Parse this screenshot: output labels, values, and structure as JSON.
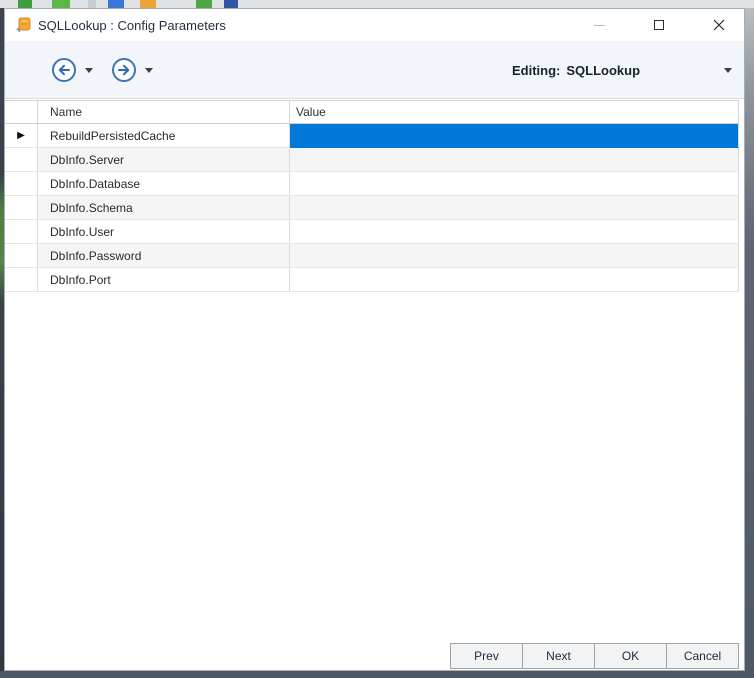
{
  "window": {
    "title": "SQLLookup : Config Parameters"
  },
  "toolbar": {
    "editing_label": "Editing:",
    "editing_value": "SQLLookup"
  },
  "grid": {
    "columns": [
      "Name",
      "Value"
    ],
    "row_indicator_glyph": "▶",
    "rows": [
      {
        "name": "RebuildPersistedCache",
        "value": "",
        "selected": true
      },
      {
        "name": "DbInfo.Server",
        "value": "",
        "selected": false
      },
      {
        "name": "DbInfo.Database",
        "value": "",
        "selected": false
      },
      {
        "name": "DbInfo.Schema",
        "value": "",
        "selected": false
      },
      {
        "name": "DbInfo.User",
        "value": "",
        "selected": false
      },
      {
        "name": "DbInfo.Password",
        "value": "",
        "selected": false
      },
      {
        "name": "DbInfo.Port",
        "value": "",
        "selected": false
      }
    ]
  },
  "footer": {
    "buttons": [
      "Prev",
      "Next",
      "OK",
      "Cancel"
    ]
  },
  "colors": {
    "selection_blue": "#0078d7",
    "toolbar_background": "#f2f5f9",
    "nav_icon_blue": "#3c72b0",
    "app_icon_orange": "#f0a43c",
    "background_edge_dark": "#4d5866"
  },
  "icons": {
    "app-icon": "orange-database-box",
    "minimize-icon": "dash (disabled)",
    "maximize-icon": "square-outline",
    "close-icon": "x-cross",
    "back-icon": "circled-arrow-left",
    "forward-icon": "circled-arrow-right",
    "dropdown-caret-icon": "▾",
    "row-indicator-icon": "▶"
  }
}
